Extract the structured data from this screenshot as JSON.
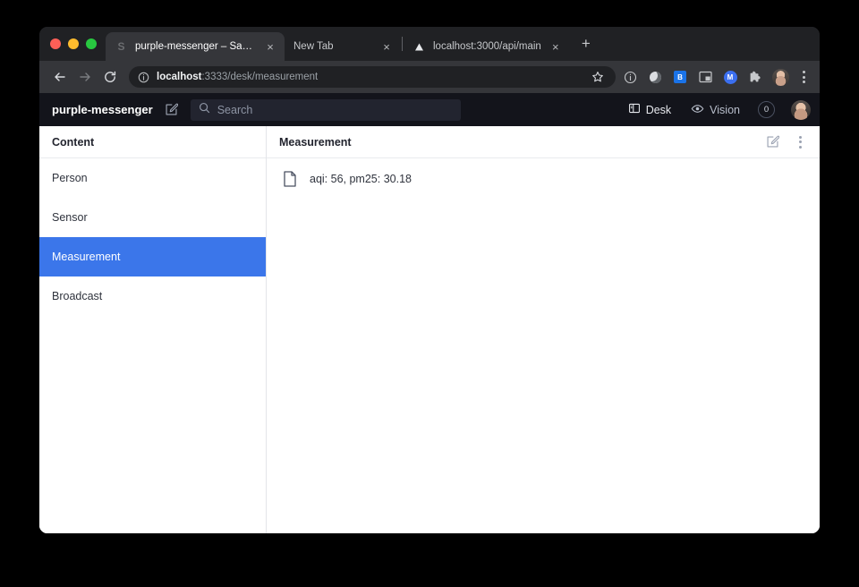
{
  "browser": {
    "tabs": [
      {
        "title": "purple-messenger – Sanity",
        "favicon": "sanity-s-icon",
        "active": true,
        "close_label": "×"
      },
      {
        "title": "New Tab",
        "favicon": "none",
        "active": false,
        "close_label": "×"
      },
      {
        "title": "localhost:3000/api/main",
        "favicon": "triangle-icon",
        "active": false,
        "close_label": "×"
      }
    ],
    "new_tab_label": "+",
    "nav": {
      "back_icon": "back-arrow-icon",
      "forward_icon": "forward-arrow-icon",
      "reload_icon": "reload-icon"
    },
    "omnibox": {
      "site_info_icon": "info-circle-icon",
      "host": "localhost",
      "path": ":3333/desk/measurement",
      "star_icon": "star-icon"
    },
    "toolbar_icons": [
      "info-circle-icon",
      "reader-mode-icon",
      "blue-extension-icon",
      "picture-in-picture-icon",
      "messenger-extension-icon",
      "puzzle-extensions-icon",
      "profile-avatar",
      "chrome-menu-icon"
    ],
    "extension_blue_label": "B",
    "extension_m_label": "M"
  },
  "studio": {
    "brand": "purple-messenger",
    "compose_icon": "compose-icon",
    "search": {
      "icon": "search-icon",
      "placeholder": "Search",
      "value": ""
    },
    "tabs": [
      {
        "label": "Desk",
        "icon": "desk-panel-icon",
        "active": true
      },
      {
        "label": "Vision",
        "icon": "eye-icon",
        "active": false
      }
    ],
    "badge_count": "0",
    "avatar": "user-avatar"
  },
  "content_pane": {
    "title": "Content",
    "items": [
      {
        "label": "Person",
        "selected": false
      },
      {
        "label": "Sensor",
        "selected": false
      },
      {
        "label": "Measurement",
        "selected": true
      },
      {
        "label": "Broadcast",
        "selected": false
      }
    ]
  },
  "document_pane": {
    "title": "Measurement",
    "edit_icon": "edit-square-icon",
    "menu_icon": "more-vertical-icon",
    "documents": [
      {
        "title": "aqi: 56, pm25: 30.18",
        "icon": "document-icon"
      }
    ]
  },
  "colors": {
    "accent_blue": "#3b76ea",
    "studio_dark": "#13141b",
    "browser_chrome": "#35363a",
    "browser_tabbar": "#202124"
  }
}
